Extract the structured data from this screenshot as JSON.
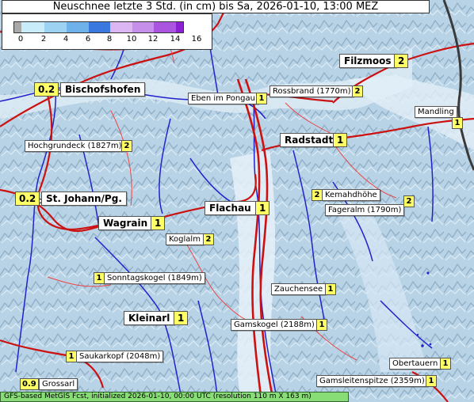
{
  "title": "Neuschnee letzte 3 Std. (in cm) bis Sa, 2026-01-10, 13:00 MEZ",
  "legend": {
    "ticks": [
      "0",
      "2",
      "4",
      "6",
      "8",
      "10",
      "12",
      "14",
      "16"
    ],
    "colors": [
      "#a9a9a9",
      "#c8ecfa",
      "#9dd2f3",
      "#6fb2ea",
      "#3a78e0",
      "#dcb6f2",
      "#c690ea",
      "#a955e0",
      "#8a20d2"
    ]
  },
  "places": [
    {
      "name": "Filzmoos",
      "value": "2",
      "kind": "town"
    },
    {
      "name": "Bischofshofen",
      "value": "0.2",
      "kind": "town"
    },
    {
      "name": "Eben im Pongau",
      "value": "1",
      "kind": "site"
    },
    {
      "name": "Rossbrand (1770m)",
      "value": "2",
      "kind": "peak"
    },
    {
      "name": "Mandling",
      "value": "1",
      "kind": "site"
    },
    {
      "name": "Radstadt",
      "value": "1",
      "kind": "town"
    },
    {
      "name": "Hochgrundeck (1827m)",
      "value": "2",
      "kind": "peak"
    },
    {
      "name": "Kemahdhöhe",
      "value": "2",
      "kind": "peak"
    },
    {
      "name": "St. Johann/Pg.",
      "value": "0.2",
      "kind": "town"
    },
    {
      "name": "Fageralm (1790m)",
      "value": "2",
      "kind": "peak"
    },
    {
      "name": "Flachau",
      "value": "1",
      "kind": "town"
    },
    {
      "name": "Wagrain",
      "value": "1",
      "kind": "town"
    },
    {
      "name": "Koglalm",
      "value": "2",
      "kind": "peak"
    },
    {
      "name": "Sonntagskogel (1849m)",
      "value": "1",
      "kind": "peak"
    },
    {
      "name": "Zauchensee",
      "value": "1",
      "kind": "site"
    },
    {
      "name": "Kleinarl",
      "value": "1",
      "kind": "town"
    },
    {
      "name": "Gamskogel (2188m)",
      "value": "1",
      "kind": "peak"
    },
    {
      "name": "Saukarkopf (2048m)",
      "value": "1",
      "kind": "peak"
    },
    {
      "name": "Obertauern",
      "value": "1",
      "kind": "site"
    },
    {
      "name": "Grossarl",
      "value": "0.9",
      "kind": "site"
    },
    {
      "name": "Gamsleitenspitze (2359m)",
      "value": "1",
      "kind": "peak"
    }
  ],
  "footer": "GFS-based MetGIS Fcst, initialized 2026-01-10, 00:00 UTC  (resolution 110 m X 163 m)"
}
